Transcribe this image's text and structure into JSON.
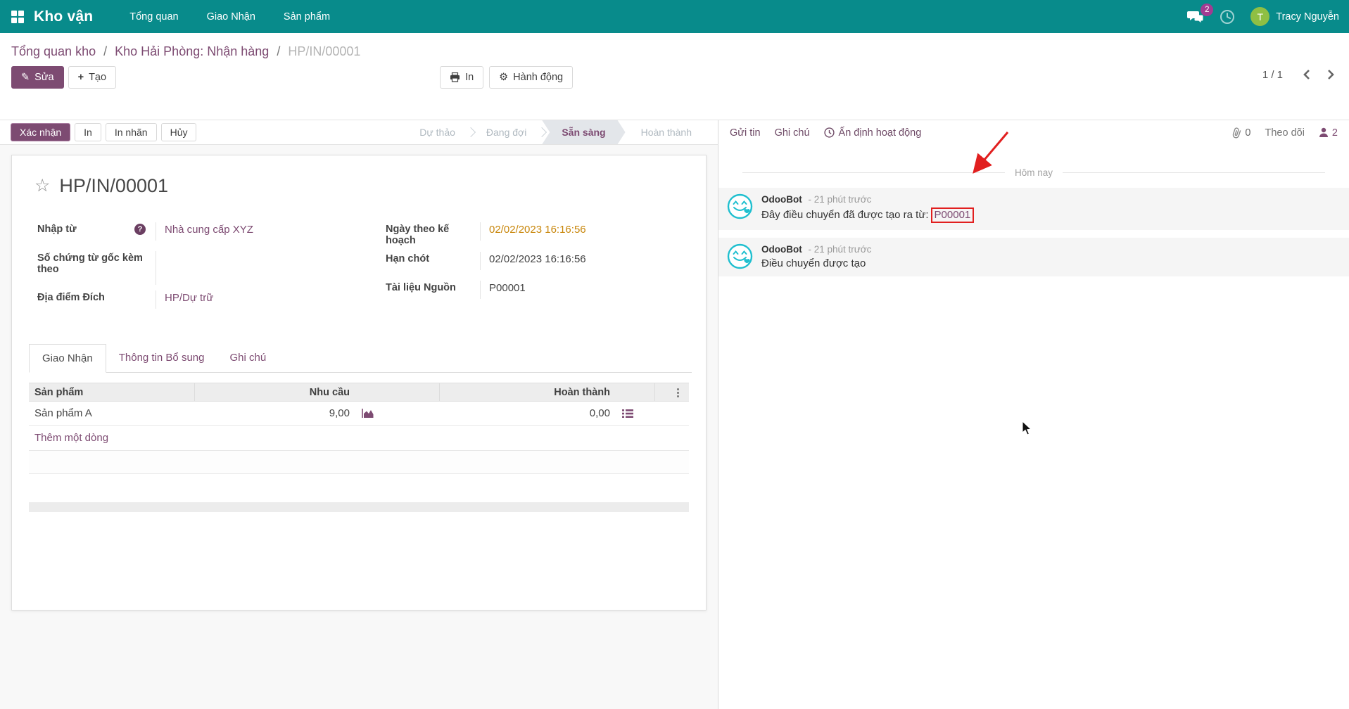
{
  "navbar": {
    "app_name": "Kho vận",
    "menus": [
      "Tổng quan",
      "Giao Nhận",
      "Sản phẩm"
    ],
    "messages_badge": "2",
    "user_initial": "T",
    "user_name": "Tracy Nguyễn"
  },
  "breadcrumb": {
    "item1": "Tổng quan kho",
    "item2": "Kho Hải Phòng: Nhận hàng",
    "sep": "/",
    "current": "HP/IN/00001"
  },
  "actions": {
    "edit": "Sửa",
    "create": "Tạo",
    "print": "In",
    "action": "Hành động",
    "pager": "1 / 1"
  },
  "statusbar": {
    "confirm": "Xác nhận",
    "print": "In",
    "print_label": "In nhãn",
    "cancel": "Hủy",
    "steps": [
      {
        "label": "Dự thảo"
      },
      {
        "label": "Đang đợi"
      },
      {
        "label": "Sẵn sàng"
      },
      {
        "label": "Hoàn thành"
      }
    ]
  },
  "chatter": {
    "send": "Gửi tin",
    "note": "Ghi chú",
    "schedule": "Ấn định hoạt động",
    "attachments_count": "0",
    "follow": "Theo dõi",
    "followers_count": "2",
    "date_divider": "Hôm nay",
    "messages": [
      {
        "author": "OdooBot",
        "time": "- 21 phút trước",
        "body_prefix": "Đây điều chuyển đã được tạo ra từ:",
        "body_link": "P00001"
      },
      {
        "author": "OdooBot",
        "time": "- 21 phút trước",
        "body_prefix": "Điều chuyển được tạo",
        "body_link": ""
      }
    ]
  },
  "form": {
    "title": "HP/IN/00001",
    "fields": {
      "partner_label": "Nhập từ",
      "partner_value": "Nhà cung cấp XYZ",
      "origin_doc_label": "Số chứng từ gốc kèm theo",
      "origin_doc_value": "",
      "dest_label": "Địa điểm Đích",
      "dest_value": "HP/Dự trữ",
      "scheduled_label": "Ngày theo kế hoạch",
      "scheduled_value": "02/02/2023 16:16:56",
      "deadline_label": "Hạn chót",
      "deadline_value": "02/02/2023 16:16:56",
      "source_label": "Tài liệu Nguồn",
      "source_value": "P00001"
    },
    "tabs": [
      {
        "label": "Giao Nhận"
      },
      {
        "label": "Thông tin Bổ sung"
      },
      {
        "label": "Ghi chú"
      }
    ],
    "table": {
      "col_product": "Sản phẩm",
      "col_demand": "Nhu cầu",
      "col_done": "Hoàn thành",
      "rows": [
        {
          "product": "Sản phẩm A",
          "demand": "9,00",
          "done": "0,00"
        }
      ],
      "add_line": "Thêm một dòng"
    }
  },
  "icons": {
    "edit_glyph": "✎",
    "create_glyph": "+",
    "gear_glyph": "⚙",
    "star_glyph": "☆",
    "help_glyph": "?",
    "kebab_glyph": "⋮"
  },
  "colors": {
    "navbar_teal": "#088b8b",
    "primary_purple": "#7d4b72",
    "badge_magenta": "#a23b92",
    "avatar_green": "#8fbf44",
    "date_orange": "#c8860a",
    "odoobot_teal": "#1fbfcf",
    "annotation_red": "#e11f1f"
  }
}
